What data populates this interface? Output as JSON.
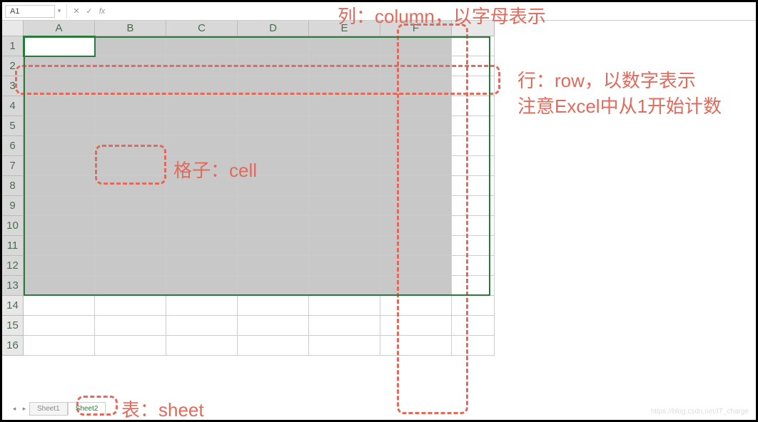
{
  "formula_bar": {
    "name_box_value": "A1",
    "cancel_icon": "✕",
    "confirm_icon": "✓",
    "fx_label": "fx"
  },
  "columns": [
    "A",
    "B",
    "C",
    "D",
    "E",
    "F"
  ],
  "rows": [
    "1",
    "2",
    "3",
    "4",
    "5",
    "6",
    "7",
    "8",
    "9",
    "10",
    "11",
    "12",
    "13",
    "14",
    "15",
    "16"
  ],
  "selected": {
    "rows_to": 13,
    "cols_to": 6
  },
  "tabs": {
    "sheet1": "Sheet1",
    "sheet2": "Sheet2"
  },
  "annotations": {
    "column_label": "列：column，以字母表示",
    "row_label_1": "行：row，以数字表示",
    "row_label_2": "注意Excel中从1开始计数",
    "cell_label": "格子：cell",
    "sheet_label": "表：sheet"
  },
  "watermark": "https://blog.csdn.net/IT_charge"
}
